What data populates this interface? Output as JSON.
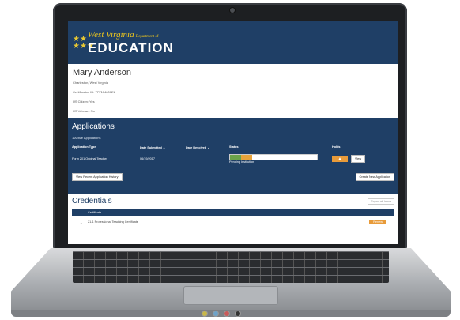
{
  "header": {
    "logo_state": "West Virginia",
    "logo_dept": "Department of",
    "logo_main": "EDUCATION",
    "colors": {
      "navy": "#1f3f66",
      "gold": "#f1c81c",
      "orange": "#e89b3a"
    }
  },
  "profile": {
    "name": "Mary Anderson",
    "location": "Charleston, West Virginia",
    "cert_id": "Certification ID: 77V10460021",
    "citizen": "US Citizen: Yes",
    "veteran": "US Veteran: No"
  },
  "applications": {
    "title": "Applications",
    "subtitle": "1 Active Applications",
    "columns": [
      "Application Type",
      "Date Submitted ⌄",
      "Date Resolved ⌄",
      "Status",
      "Holds"
    ],
    "rows": [
      {
        "type": "Form 201 Original Teacher",
        "submitted": "06/19/2017",
        "resolved": "",
        "status": "Pending Institution",
        "hold_icon": "warning-icon",
        "view_label": "View"
      }
    ],
    "history_button": "View Recent Application History",
    "create_button": "Create New Application"
  },
  "credentials": {
    "title": "Credentials",
    "export_label": "Export all icons",
    "column": "Certificate",
    "rows": [
      {
        "name": "21-1 Professional Teaching Certificate",
        "action": "Renew"
      }
    ]
  }
}
